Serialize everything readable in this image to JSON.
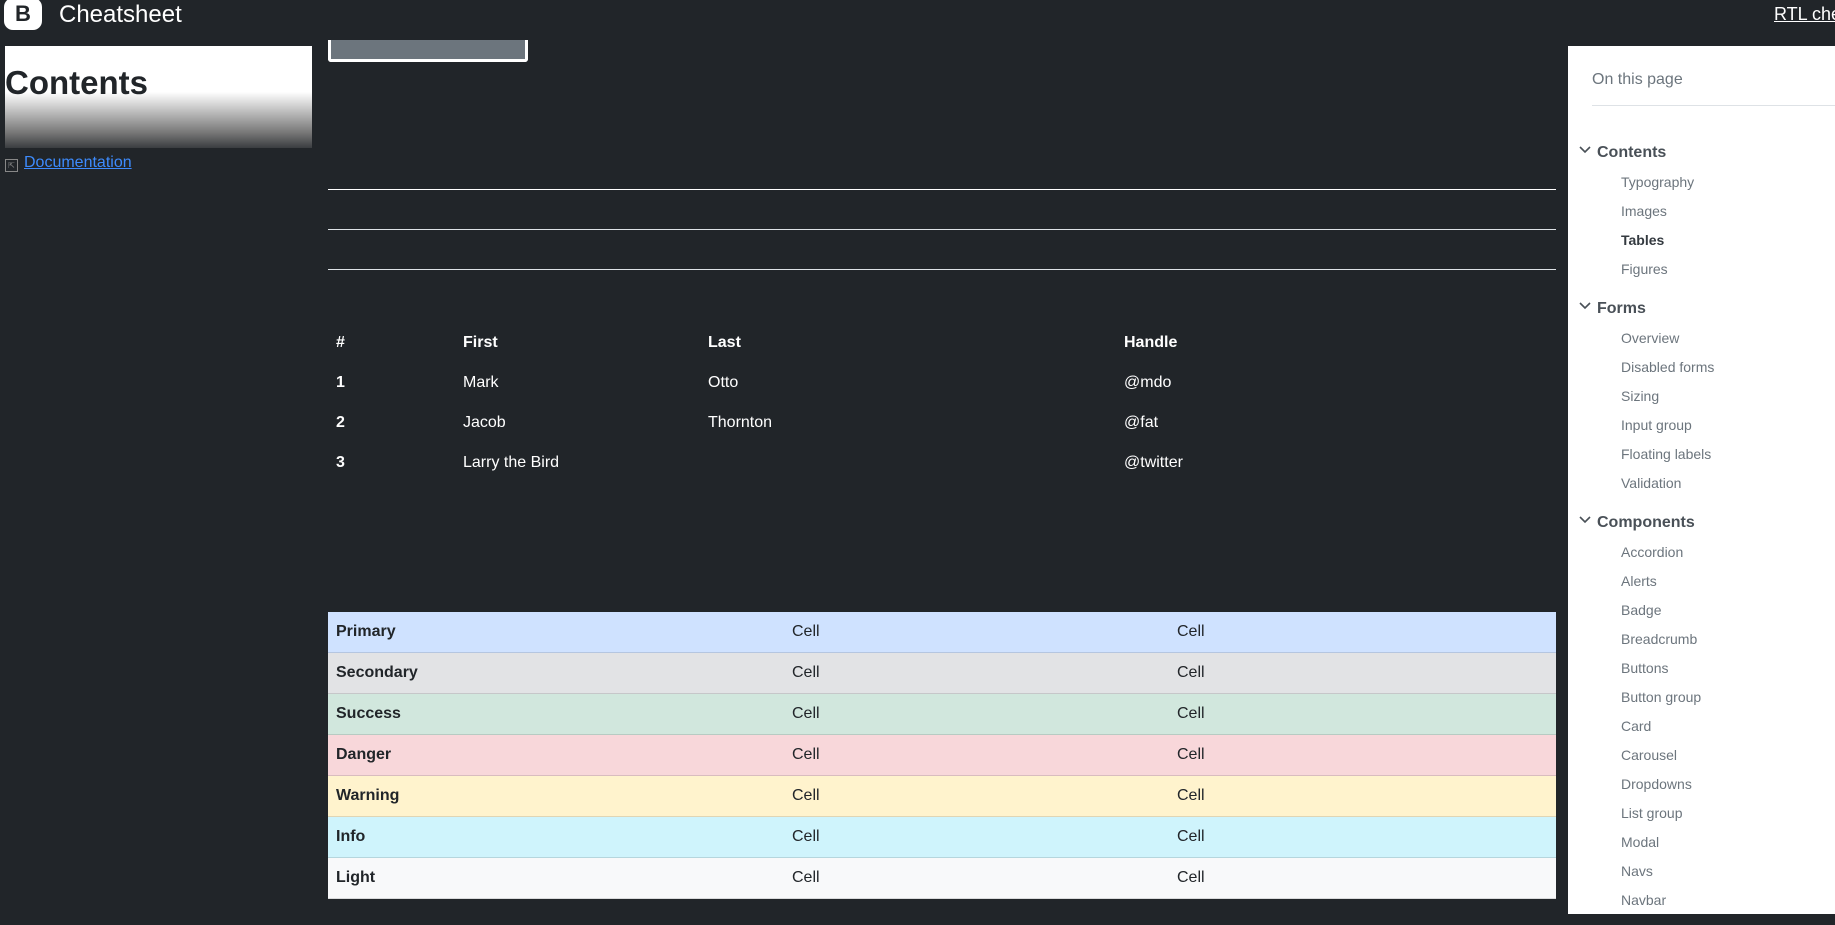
{
  "header": {
    "brand_letter": "B",
    "brand_name": "Cheatsheet",
    "rtl_link": "RTL chea"
  },
  "sidebar": {
    "contents_title": "Contents",
    "doc_link": "Documentation"
  },
  "dark_table": {
    "headers": [
      "#",
      "First",
      "Last",
      "Handle"
    ],
    "rows": [
      [
        "1",
        "Mark",
        "Otto",
        "@mdo"
      ],
      [
        "2",
        "Jacob",
        "Thornton",
        "@fat"
      ],
      [
        "3",
        "Larry the Bird",
        "",
        "@twitter"
      ]
    ]
  },
  "color_table": {
    "rows": [
      {
        "name": "Primary",
        "c1": "Cell",
        "c2": "Cell",
        "bg": "#cfe2ff"
      },
      {
        "name": "Secondary",
        "c1": "Cell",
        "c2": "Cell",
        "bg": "#e2e3e5"
      },
      {
        "name": "Success",
        "c1": "Cell",
        "c2": "Cell",
        "bg": "#d1e7dd"
      },
      {
        "name": "Danger",
        "c1": "Cell",
        "c2": "Cell",
        "bg": "#f8d7da"
      },
      {
        "name": "Warning",
        "c1": "Cell",
        "c2": "Cell",
        "bg": "#fff3cd"
      },
      {
        "name": "Info",
        "c1": "Cell",
        "c2": "Cell",
        "bg": "#cff4fc"
      },
      {
        "name": "Light",
        "c1": "Cell",
        "c2": "Cell",
        "bg": "#f8f9fa"
      }
    ]
  },
  "toc": {
    "title": "On this page",
    "groups": [
      {
        "label": "Contents",
        "items": [
          "Typography",
          "Images",
          "Tables",
          "Figures"
        ],
        "active": "Tables"
      },
      {
        "label": "Forms",
        "items": [
          "Overview",
          "Disabled forms",
          "Sizing",
          "Input group",
          "Floating labels",
          "Validation"
        ]
      },
      {
        "label": "Components",
        "items": [
          "Accordion",
          "Alerts",
          "Badge",
          "Breadcrumb",
          "Buttons",
          "Button group",
          "Card",
          "Carousel",
          "Dropdowns",
          "List group",
          "Modal",
          "Navs",
          "Navbar"
        ]
      }
    ]
  }
}
